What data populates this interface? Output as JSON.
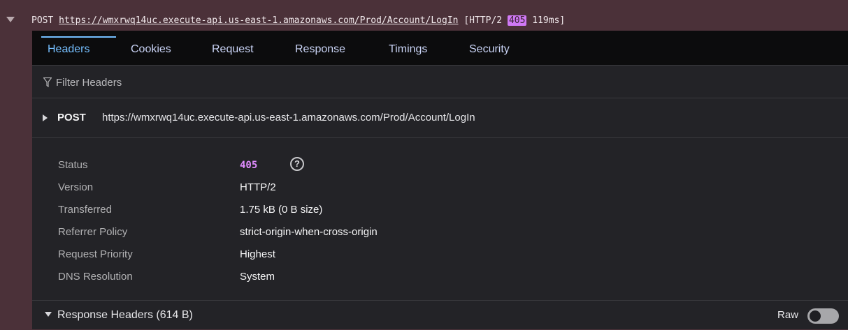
{
  "request_line": {
    "method": "POST",
    "url": "https://wmxrwq14uc.execute-api.us-east-1.amazonaws.com/Prod/Account/LogIn",
    "protocol_prefix": "[HTTP/2 ",
    "status_code": "405",
    "time": " 119ms]"
  },
  "tabs": [
    {
      "label": "Headers"
    },
    {
      "label": "Cookies"
    },
    {
      "label": "Request"
    },
    {
      "label": "Response"
    },
    {
      "label": "Timings"
    },
    {
      "label": "Security"
    }
  ],
  "filter": {
    "placeholder": "Filter Headers",
    "icon": "filter-icon"
  },
  "request_section": {
    "method": "POST",
    "url": "https://wmxrwq14uc.execute-api.us-east-1.amazonaws.com/Prod/Account/LogIn"
  },
  "summary": {
    "status_label": "Status",
    "status_value": "405",
    "version_label": "Version",
    "version_value": "HTTP/2",
    "transferred_label": "Transferred",
    "transferred_value": "1.75 kB (0 B size)",
    "referrer_label": "Referrer Policy",
    "referrer_value": "strict-origin-when-cross-origin",
    "priority_label": "Request Priority",
    "priority_value": "Highest",
    "dns_label": "DNS Resolution",
    "dns_value": "System"
  },
  "response_headers": {
    "label": "Response Headers (614 B)",
    "raw_label": "Raw",
    "raw_enabled": false
  },
  "colors": {
    "accent": "#75bfff",
    "status_highlight": "#e08cff",
    "panel_bg": "#232327",
    "row_bg": "#4b3139"
  }
}
